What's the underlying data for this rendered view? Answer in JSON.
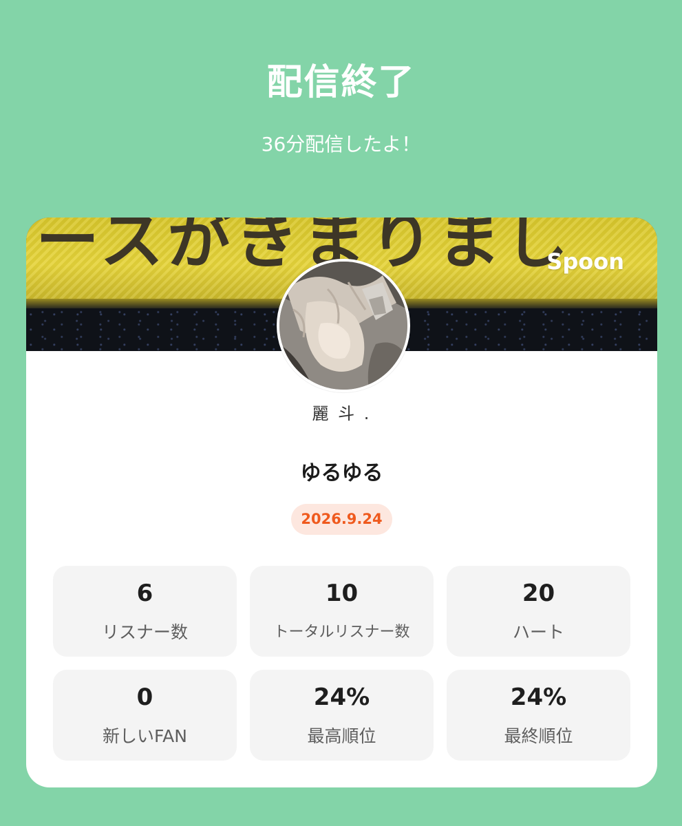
{
  "header": {
    "title": "配信終了",
    "subtitle": "36分配信したよ！"
  },
  "banner": {
    "text": "ースがきまりまし",
    "logo": "Spoon"
  },
  "profile": {
    "avatar_icon": "avatar-illustration",
    "dj_name": "麗 斗 .",
    "live_title": "ゆるゆる",
    "date": "2026.9.24"
  },
  "colors": {
    "background": "#83d4a8",
    "card": "#ffffff",
    "stat_tile": "#f4f4f4",
    "date_badge_bg": "#fde7df",
    "date_badge_text": "#ef5a1e"
  },
  "stats": [
    {
      "value": "6",
      "label": "リスナー数"
    },
    {
      "value": "10",
      "label": "トータルリスナー数"
    },
    {
      "value": "20",
      "label": "ハート"
    },
    {
      "value": "0",
      "label": "新しいFAN"
    },
    {
      "value": "24%",
      "label": "最高順位"
    },
    {
      "value": "24%",
      "label": "最終順位"
    }
  ]
}
